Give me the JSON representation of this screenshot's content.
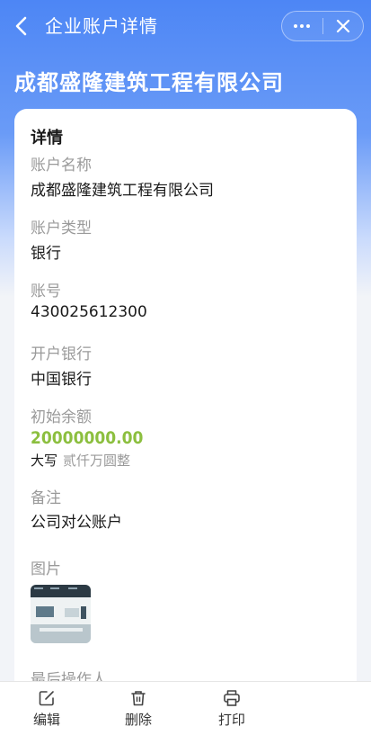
{
  "navbar": {
    "title": "企业账户详情"
  },
  "header": {
    "company_name": "成都盛隆建筑工程有限公司"
  },
  "details": {
    "section_title": "详情",
    "account_name_label": "账户名称",
    "account_name": "成都盛隆建筑工程有限公司",
    "account_type_label": "账户类型",
    "account_type": "银行",
    "account_no_label": "账号",
    "account_no": "430025612300",
    "bank_label": "开户银行",
    "bank": "中国银行",
    "initial_balance_label": "初始余额",
    "initial_balance": "20000000.00",
    "uppercase_label": "大写",
    "uppercase_value": "贰仟万圆整",
    "remark_label": "备注",
    "remark": "公司对公账户",
    "image_label": "图片",
    "last_operator_label": "最后操作人"
  },
  "actions": {
    "edit": "编辑",
    "delete": "删除",
    "print": "打印"
  },
  "colors": {
    "accent": "#4d86f5",
    "balance": "#8cbf3f"
  }
}
